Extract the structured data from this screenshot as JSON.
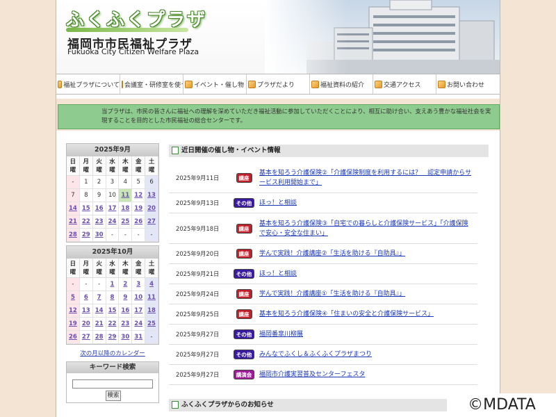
{
  "header": {
    "logo_text": "ふくふくプラザ",
    "site_name": "福岡市市民福祉プラザ",
    "site_name_en": "Fukuoka City Citizen Welfare Plaza"
  },
  "nav": {
    "items": [
      {
        "label": "福祉プラザについて"
      },
      {
        "label": "会議室・研修室を使う"
      },
      {
        "label": "イベント・催し物"
      },
      {
        "label": "プラザだより"
      },
      {
        "label": "福祉資料の紹介"
      },
      {
        "label": "交通アクセス"
      },
      {
        "label": "お問い合わせ"
      }
    ]
  },
  "intro": {
    "text": "当プラザは、市民の皆さんに福祉への理解を深めていただき福祉活動に参加していただくことにより、相互に助け合い、支えあう豊かな福祉社会を実現することを目的とした市民福祉の総合センターです。"
  },
  "calendars": [
    {
      "title": "2025年9月",
      "weekdays": [
        "日曜",
        "月曜",
        "火曜",
        "水曜",
        "木曜",
        "金曜",
        "土曜"
      ],
      "weeks": [
        [
          "-",
          "1",
          "2",
          "3",
          "4",
          "5",
          "6"
        ],
        [
          "7",
          "8",
          "9",
          "10",
          "11",
          "12",
          "13"
        ],
        [
          "14",
          "15",
          "16",
          "17",
          "18",
          "19",
          "20"
        ],
        [
          "21",
          "22",
          "23",
          "24",
          "25",
          "26",
          "27"
        ],
        [
          "28",
          "29",
          "30",
          "-",
          "-",
          "-",
          "-"
        ]
      ]
    },
    {
      "title": "2025年10月",
      "weekdays": [
        "日曜",
        "月曜",
        "火曜",
        "水曜",
        "木曜",
        "金曜",
        "土曜"
      ],
      "weeks": [
        [
          "-",
          "-",
          "-",
          "1",
          "2",
          "3",
          "4"
        ],
        [
          "5",
          "6",
          "7",
          "8",
          "9",
          "10",
          "11"
        ],
        [
          "12",
          "13",
          "14",
          "15",
          "16",
          "17",
          "18"
        ],
        [
          "19",
          "20",
          "21",
          "22",
          "23",
          "24",
          "25"
        ],
        [
          "26",
          "27",
          "28",
          "29",
          "30",
          "31",
          "-"
        ]
      ]
    }
  ],
  "next_calendar_link": "次の月以降のカレンダー",
  "keyword_search": {
    "title": "キーワード検索",
    "input_value": "",
    "button_label": "検索"
  },
  "events": {
    "heading": "近日開催の催し物・イベント情報",
    "items": [
      {
        "date": "2025年9月11日",
        "badge": "講座",
        "badge_color": "#c0202a",
        "title": "基本を知ろう介護保険②「介護保険制度を利用するには？　認定申請からサービス利用開始まで」"
      },
      {
        "date": "2025年9月13日",
        "badge": "その他",
        "badge_color": "#3a1aa0",
        "title": "ほっ！と相談"
      },
      {
        "date": "2025年9月18日",
        "badge": "講座",
        "badge_color": "#c0202a",
        "title": "基本を知ろう介護保険③「自宅での暮らしと介護保険サービス」「介護保険で安心・安全な住まい」"
      },
      {
        "date": "2025年9月20日",
        "badge": "講座",
        "badge_color": "#c0202a",
        "title": "学んで実践！介護講座②「生活を助ける『自助具』」"
      },
      {
        "date": "2025年9月21日",
        "badge": "その他",
        "badge_color": "#3a1aa0",
        "title": "ほっ！と相談"
      },
      {
        "date": "2025年9月24日",
        "badge": "講座",
        "badge_color": "#c0202a",
        "title": "学んで実践！介護講座①「生活を助ける『自助具』」"
      },
      {
        "date": "2025年9月25日",
        "badge": "講座",
        "badge_color": "#c0202a",
        "title": "基本を知ろう介護保険④「住まいの安全と介護保険サービス」"
      },
      {
        "date": "2025年9月27日",
        "badge": "その他",
        "badge_color": "#3a1aa0",
        "title": "福岡番皐川柳展"
      },
      {
        "date": "2025年9月27日",
        "badge": "その他",
        "badge_color": "#3a1aa0",
        "title": "みんなでふくし＆ふくふくプラザまつり"
      },
      {
        "date": "2025年9月27日",
        "badge": "講演会",
        "badge_color": "#a01a9a",
        "title": "福岡市介護実習普及センターフェスタ"
      }
    ]
  },
  "notice": {
    "heading": "ふくふくプラザからのお知らせ"
  },
  "watermark": "©MDATA"
}
